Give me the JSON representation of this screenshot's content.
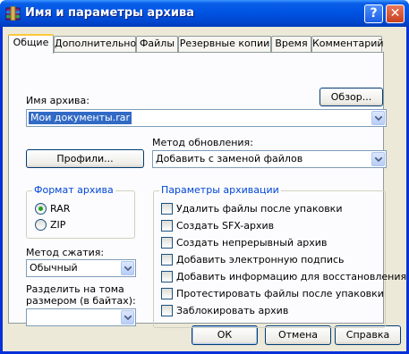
{
  "window": {
    "title": "Имя и параметры архива"
  },
  "titlebar": {
    "help_glyph": "?",
    "close_glyph": "✕"
  },
  "tabs": [
    {
      "label": "Общие",
      "active": true
    },
    {
      "label": "Дополнительно"
    },
    {
      "label": "Файлы"
    },
    {
      "label": "Резервные копии"
    },
    {
      "label": "Время"
    },
    {
      "label": "Комментарий"
    }
  ],
  "archive_name": {
    "label": "Имя архива:",
    "value": "Мои документы.rar",
    "browse_label": "Обзор..."
  },
  "update_method": {
    "label": "Метод обновления:",
    "value": "Добавить с заменой файлов"
  },
  "profiles": {
    "label": "Профили..."
  },
  "archive_format": {
    "title": "Формат архива",
    "options": [
      "RAR",
      "ZIP"
    ],
    "selected": "RAR"
  },
  "compression": {
    "label": "Метод сжатия:",
    "value": "Обычный"
  },
  "split": {
    "label_line1": "Разделить на тома",
    "label_line2": "размером (в байтах):",
    "value": ""
  },
  "archive_params": {
    "title": "Параметры архивации",
    "options": [
      {
        "label": "Удалить файлы после упаковки",
        "checked": false
      },
      {
        "label": "Создать SFX-архив",
        "checked": false
      },
      {
        "label": "Создать непрерывный архив",
        "checked": false
      },
      {
        "label": "Добавить электронную подпись",
        "checked": false
      },
      {
        "label": "Добавить информацию для восстановления",
        "checked": false
      },
      {
        "label": "Протестировать файлы после упаковки",
        "checked": false
      },
      {
        "label": "Заблокировать архив",
        "checked": false
      }
    ]
  },
  "buttons": {
    "ok": "ОК",
    "cancel": "Отмена",
    "help": "Справка"
  },
  "colors": {
    "titlebar": "#0054e3",
    "group_title": "#0046d5",
    "dialog_bg": "#ece9d8",
    "selection": "#316ac5"
  }
}
